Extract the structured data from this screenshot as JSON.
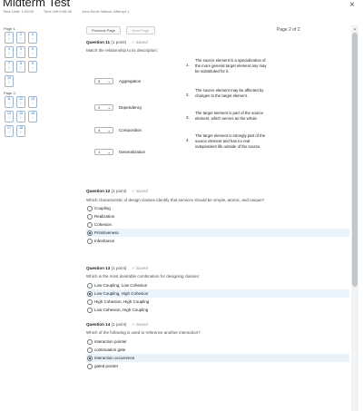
{
  "header": {
    "title": "Midterm Test",
    "time_limit": "Time Limit: 1:00:00",
    "time_left": "Time Left:0:06:45",
    "attempt": "John Kevin Valerio: Attempt 1",
    "close_label": "×"
  },
  "nav": {
    "page1_label": "Page 1:",
    "page2_label": "Page 2:",
    "page1_items": [
      "1",
      "2",
      "3",
      "4",
      "5",
      "6",
      "7",
      "8",
      "9",
      "10"
    ],
    "page2_items": [
      "11",
      "12",
      "13",
      "14",
      "15",
      "16",
      "17",
      "18"
    ],
    "check": "✓"
  },
  "pager": {
    "prev_label": "Previous Page",
    "next_label": "Next Page",
    "page_count": "Page 2 of 2"
  },
  "saved_label": "✓ Saved",
  "q11": {
    "title": "Question 11",
    "points": "(1 point)",
    "text": "Match the relationship to its description:",
    "rows": [
      {
        "value": "3",
        "label": "Aggregation"
      },
      {
        "value": "2",
        "label": "Dependency"
      },
      {
        "value": "4",
        "label": "Composition"
      },
      {
        "value": "1",
        "label": "Generalization"
      }
    ],
    "definitions": [
      {
        "num": "1.",
        "text": "The source element is a specialization of the more general target element any may be substituted for it."
      },
      {
        "num": "2.",
        "text": "The source element may be affected by changes to the target element."
      },
      {
        "num": "3.",
        "text": "The target element is part of the source element, which serves as the whole."
      },
      {
        "num": "4.",
        "text": "The target element is strongly part of the source element and has no real independent life outside of the source."
      }
    ]
  },
  "q12": {
    "title": "Question 12",
    "points": "(1 point)",
    "text": "Which characteristic of design classes identify that services should be simple, atomic, and unique?",
    "options": [
      "Coupling",
      "Realization",
      "Cohesion",
      "Primitiveness",
      "Inheritance"
    ],
    "selected": 3
  },
  "q13": {
    "title": "Question 13",
    "points": "(1 point)",
    "text": "Which is the most desirable combination for designing classes:",
    "options": [
      "Low Coupling, Low Cohesion",
      "Low Coupling, High Cohesion",
      "High Cohesion, High Coupling",
      "Low Cohesion, High Coupling"
    ],
    "selected": 1
  },
  "q14": {
    "title": "Question 14",
    "points": "(1 point)",
    "text": "Which of the following is used to reference another interaction?",
    "options": [
      "interaction pointer",
      "continuation gate",
      "interaction occurrence",
      "gated pointer"
    ],
    "selected": 2
  }
}
